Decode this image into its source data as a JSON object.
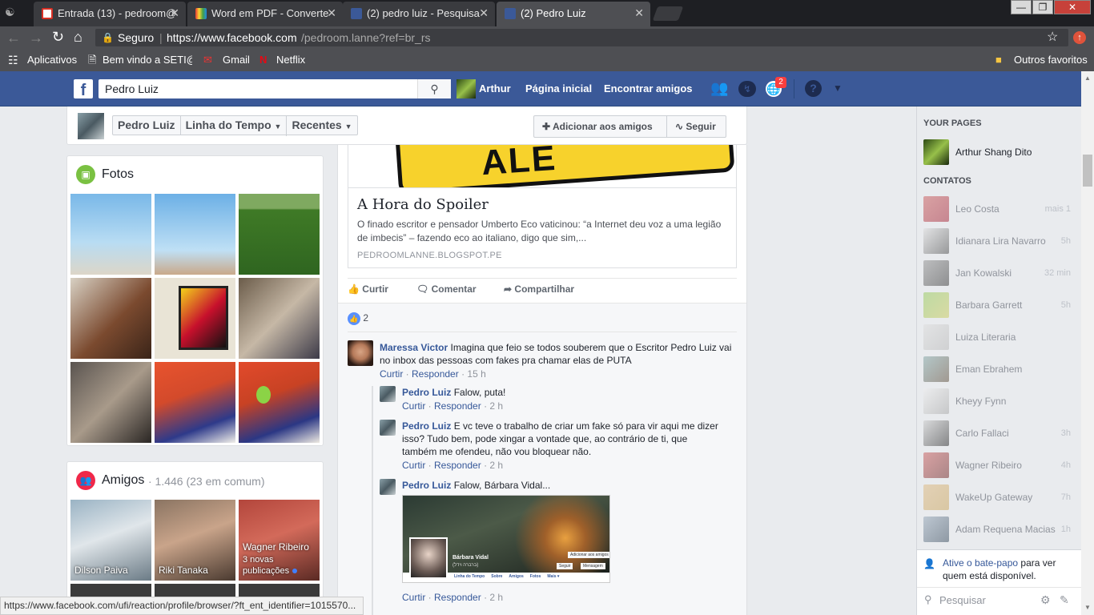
{
  "browser": {
    "tabs": [
      {
        "title": "Entrada (13) - pedroom@"
      },
      {
        "title": "Word em PDF - Converte"
      },
      {
        "title": "(2) pedro luiz - Pesquisa"
      },
      {
        "title": "(2) Pedro Luiz"
      }
    ],
    "secure_label": "Seguro",
    "url_host": "https://www.facebook.com",
    "url_path": "/pedroom.lanne?ref=br_rs",
    "bookmarks": [
      {
        "label": "Aplicativos"
      },
      {
        "label": "Bem vindo a SETI@h"
      },
      {
        "label": "Gmail"
      },
      {
        "label": "Netflix"
      }
    ],
    "other_bookmarks": "Outros favoritos",
    "status_url": "https://www.facebook.com/ufi/reaction/profile/browser/?ft_ent_identifier=1015570..."
  },
  "fb": {
    "search_value": "Pedro Luiz",
    "user_name": "Arthur",
    "nav_home": "Página inicial",
    "nav_find": "Encontrar amigos",
    "notifications_count": "2",
    "colors": {
      "blue": "#3b5998",
      "link": "#365899"
    }
  },
  "profile_bar": {
    "name": "Pedro Luiz",
    "timeline": "Linha do Tempo",
    "recent": "Recentes",
    "add_friend": "Adicionar aos amigos",
    "follow": "Seguir"
  },
  "photos": {
    "title": "Fotos"
  },
  "friends": {
    "title": "Amigos",
    "count": "· 1.446 (23 em comum)",
    "items": [
      {
        "name": "Dilson Paiva"
      },
      {
        "name": "Riki Tanaka"
      },
      {
        "name": "Wagner Ribeiro",
        "sub": "3 novas publicações"
      }
    ]
  },
  "post": {
    "link_image_text": "ALE",
    "link_title": "A Hora do Spoiler",
    "link_desc": "O finado escritor e pensador Umberto Eco vaticinou: “a Internet deu voz a uma legião de imbecis” – fazendo eco ao italiano, digo que sim,...",
    "link_domain": "PEDROOMLANNE.BLOGSPOT.PE",
    "actions": {
      "like": "Curtir",
      "comment": "Comentar",
      "share": "Compartilhar"
    },
    "likes": "2"
  },
  "comments": [
    {
      "author": "Maressa Victor",
      "text": "Imagina que feio se todos souberem que o Escritor Pedro Luiz vai no inbox das pessoas com fakes pra chamar elas de PUTA",
      "like": "Curtir",
      "reply": "Responder",
      "time": "15 h"
    },
    {
      "author": "Pedro Luiz",
      "text": "Falow, puta!",
      "like": "Curtir",
      "reply": "Responder",
      "time": "2 h"
    },
    {
      "author": "Pedro Luiz",
      "text": "E vc teve o trabalho de criar um fake só para vir aqui me dizer isso? Tudo bem, pode xingar a vontade que, ao contrário de ti, que também me ofendeu, não vou bloquear não.",
      "like": "Curtir",
      "reply": "Responder",
      "time": "2 h"
    },
    {
      "author": "Pedro Luiz",
      "text": "Falow, Bárbara Vidal...",
      "like": "Curtir",
      "reply": "Responder",
      "time": "2 h",
      "image": {
        "name": "Bárbara Vidal",
        "sub": "(ברברה וידל)",
        "add": "Adicionar aos amigos",
        "follow": "Seguir",
        "msg": "Mensagem",
        "tabs": [
          "Linha do Tempo",
          "Sobre",
          "Amigos",
          "Fotos",
          "Mais ▾"
        ]
      }
    }
  ],
  "sidebar": {
    "your_pages": "YOUR PAGES",
    "page_name": "Arthur Shang Dito",
    "contacts_title": "CONTATOS",
    "contacts": [
      {
        "name": "Leo Costa",
        "time": "mais 1"
      },
      {
        "name": "Idianara Lira Navarro",
        "time": "5h"
      },
      {
        "name": "Jan Kowalski",
        "time": "32 min"
      },
      {
        "name": "Barbara Garrett",
        "time": "5h"
      },
      {
        "name": "Luiza Literaria",
        "time": ""
      },
      {
        "name": "Eman Ebrahem",
        "time": ""
      },
      {
        "name": "Kheyy Fynn",
        "time": ""
      },
      {
        "name": "Carlo Fallaci",
        "time": "3h"
      },
      {
        "name": "Wagner Ribeiro",
        "time": "4h"
      },
      {
        "name": "WakeUp Gateway",
        "time": "7h"
      },
      {
        "name": "Adam Requena Macias",
        "time": "1h"
      }
    ],
    "chat_link": "Ative o bate-papo",
    "chat_rest": "para ver quem está disponível.",
    "search_placeholder": "Pesquisar"
  }
}
